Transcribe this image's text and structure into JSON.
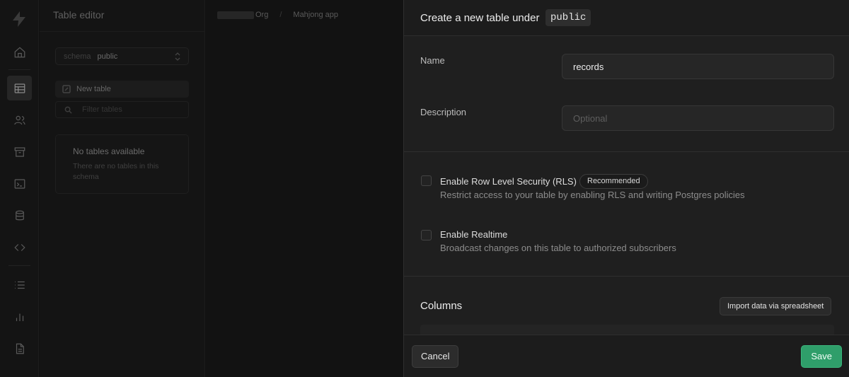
{
  "sidebar": {
    "icons": [
      "home-icon",
      "table-icon",
      "users-icon",
      "archive-icon",
      "terminal-icon",
      "database-icon",
      "code-icon",
      "list-icon",
      "bar-chart-icon",
      "document-icon"
    ]
  },
  "table_editor": {
    "title": "Table editor",
    "schema_label": "schema",
    "schema_value": "public",
    "new_table_label": "New table",
    "filter_placeholder": "Filter tables",
    "empty_title": "No tables available",
    "empty_desc": "There are no tables in this schema"
  },
  "breadcrumb": {
    "org": "Org",
    "project": "Mahjong app"
  },
  "panel": {
    "title": "Create a new table under",
    "schema_chip": "public",
    "name_label": "Name",
    "name_value": "records",
    "description_label": "Description",
    "description_placeholder": "Optional",
    "rls_title": "Enable Row Level Security (RLS)",
    "rls_badge": "Recommended",
    "rls_desc": "Restrict access to your table by enabling RLS and writing Postgres policies",
    "realtime_title": "Enable Realtime",
    "realtime_desc": "Broadcast changes on this table to authorized subscribers",
    "columns_title": "Columns",
    "import_label": "Import data via spreadsheet",
    "cancel_label": "Cancel",
    "save_label": "Save"
  },
  "colors": {
    "accent": "#2f9e6a",
    "panel_bg": "#1f1f1f",
    "app_bg": "#111111"
  }
}
